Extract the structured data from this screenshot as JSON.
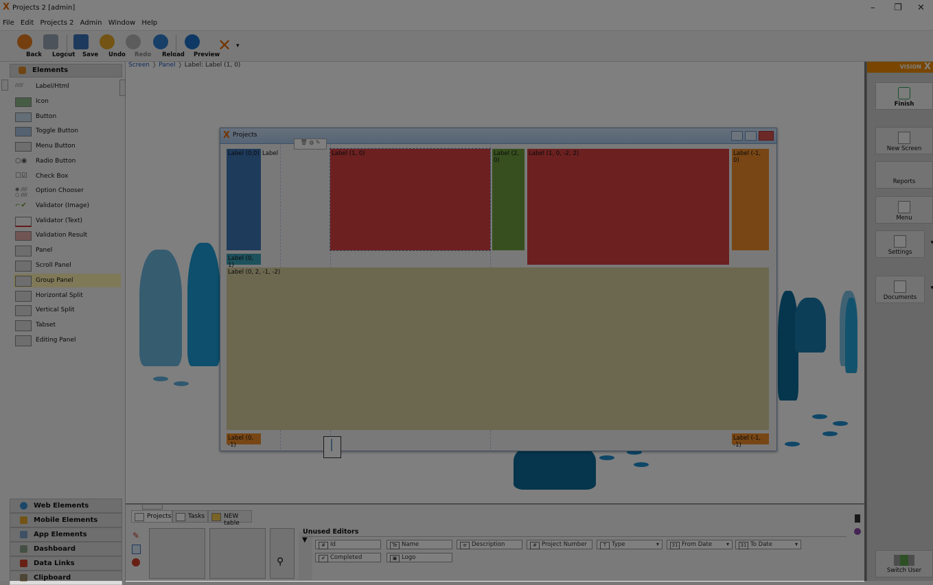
{
  "window": {
    "title": "Projects 2 [admin]",
    "controls": [
      "–",
      "❐",
      "✕"
    ]
  },
  "menu": [
    "File",
    "Edit",
    "Projects 2",
    "Admin",
    "Window",
    "Help"
  ],
  "toolbar": {
    "buttons": [
      {
        "label": "Back",
        "icon": "back-icon",
        "color": "#e87c1e"
      },
      {
        "label": "Logout",
        "icon": "logout-icon",
        "color": "#9aa7b5"
      },
      {
        "label": "Save",
        "icon": "save-icon",
        "color": "#3b73b9"
      },
      {
        "label": "Undo",
        "icon": "undo-icon",
        "color": "#e6a92a"
      },
      {
        "label": "Redo",
        "icon": "redo-icon",
        "color": "#b8b8b8"
      },
      {
        "label": "Reload",
        "icon": "reload-icon",
        "color": "#2e7fd1"
      },
      {
        "label": "Preview",
        "icon": "preview-icon",
        "color": "#1d72c8"
      }
    ]
  },
  "elements_panel": {
    "header": "Elements",
    "items": [
      {
        "label": "Label/Html"
      },
      {
        "label": "Icon"
      },
      {
        "label": "Button"
      },
      {
        "label": "Toggle Button"
      },
      {
        "label": "Menu Button"
      },
      {
        "label": "Radio Button"
      },
      {
        "label": "Check Box"
      },
      {
        "label": "Option Chooser"
      },
      {
        "label": "Validator (Image)"
      },
      {
        "label": "Validator (Text)"
      },
      {
        "label": "Validation Result"
      },
      {
        "label": "Panel"
      },
      {
        "label": "Scroll Panel"
      },
      {
        "label": "Group Panel"
      },
      {
        "label": "Horizontal Split"
      },
      {
        "label": "Vertical Split"
      },
      {
        "label": "Tabset"
      },
      {
        "label": "Editing Panel"
      }
    ],
    "categories": [
      {
        "label": "Web Elements",
        "color": "#3a8fd1"
      },
      {
        "label": "Mobile Elements",
        "color": "#e6a92a"
      },
      {
        "label": "App Elements",
        "color": "#7aa0c8"
      },
      {
        "label": "Dashboard",
        "color": "#8aa08a"
      },
      {
        "label": "Data Links",
        "color": "#d0402a"
      },
      {
        "label": "Clipboard",
        "color": "#9a8a6a"
      }
    ]
  },
  "breadcrumb": {
    "screen": "Screen",
    "panel": "Panel",
    "current": "Label: Label (1, 0)"
  },
  "designer": {
    "window_title": "Projects",
    "labels": {
      "l00": "Label (0,0)",
      "label": "Label",
      "l10": "Label (1, 0)",
      "l20": "Label (2, 0)",
      "l10m22": "Label (1, 0, -2, 2)",
      "lm10": "Label (-1, 0)",
      "l01": "Label (0, 1)",
      "l02": "Label (0, 2, -1, -2)",
      "l0m1": "Label (0, -1)",
      "lm1m1": "Label (-1, -1)"
    }
  },
  "bottom_panel": {
    "tabs": [
      "Projects",
      "Tasks",
      "NEW table"
    ],
    "unused_editors_title": "Unused Editors",
    "editors_row1": [
      {
        "label": "Id",
        "icon": "#"
      },
      {
        "label": "Name",
        "icon": "Te"
      },
      {
        "label": "Description",
        "icon": "≡"
      },
      {
        "label": "Project Number",
        "icon": "#"
      },
      {
        "label": "Type",
        "icon": "T"
      },
      {
        "label": "From Date",
        "icon": "31"
      },
      {
        "label": "To Date",
        "icon": "31"
      }
    ],
    "editors_row2": [
      {
        "label": "Completed",
        "icon": "✔"
      },
      {
        "label": "Logo",
        "icon": "▣"
      }
    ]
  },
  "right_panel": {
    "brand": "VISION",
    "buttons": [
      "Finish",
      "New Screen",
      "Reports",
      "Menu",
      "Settings",
      "Documents"
    ],
    "switch_user": "Switch User"
  }
}
